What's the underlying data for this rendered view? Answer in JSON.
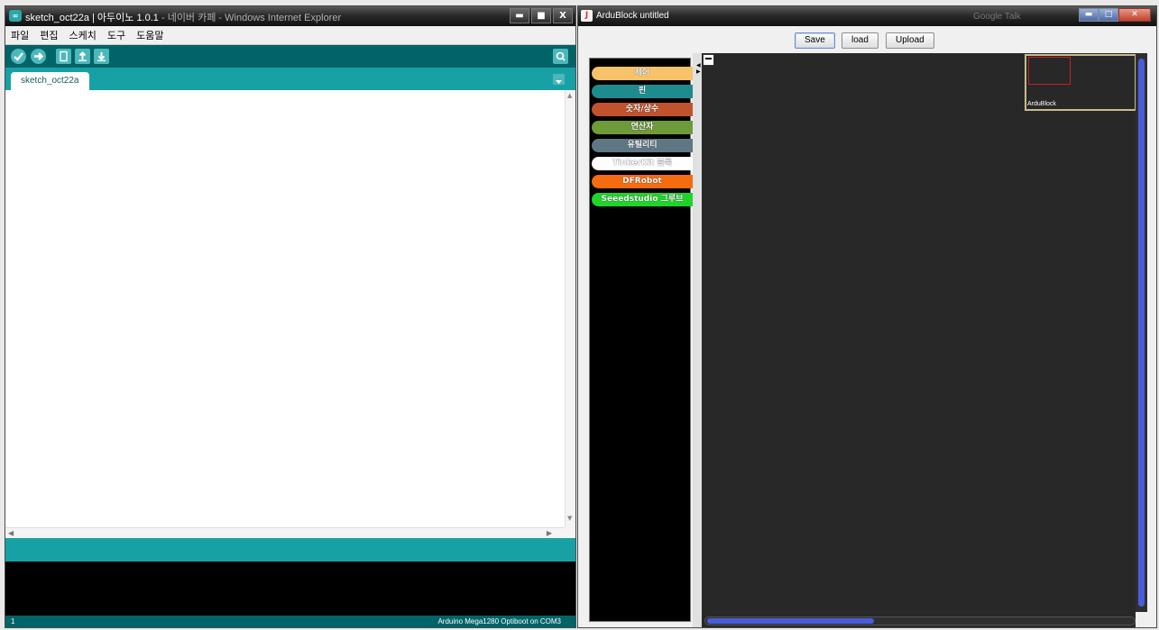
{
  "ide": {
    "title_active": "sketch_oct22a | 아두이노 1.0.1",
    "title_behind": " - 네이버 카페 - Windows Internet Explorer",
    "logo": "∞",
    "window_buttons": {
      "minimize": "▬",
      "maximize": "■",
      "close": "X"
    },
    "menu": [
      "파일",
      "편집",
      "스케치",
      "도구",
      "도움말"
    ],
    "toolbar": {
      "buttons": [
        "verify-icon",
        "upload-arrow-icon",
        "new-file-icon",
        "open-file-icon",
        "save-file-icon"
      ],
      "serial_monitor": "serial-monitor-icon"
    },
    "tab": {
      "label": "sketch_oct22a"
    },
    "scroll": {
      "up": "▲",
      "down": "▼",
      "left": "◀",
      "right": "▶"
    },
    "footer": {
      "line": "1",
      "board": "Arduino Mega1280 Optiboot on COM3"
    },
    "colors": {
      "dark_teal": "#006468",
      "teal": "#17a1a5",
      "button": "#4db7bb"
    }
  },
  "ardublock": {
    "title": "ArduBlock untitled",
    "background_app": "Google Talk",
    "window_buttons": {
      "minimize": "▬",
      "maximize": "□",
      "close": "✕"
    },
    "buttons": {
      "save": "Save",
      "load": "load",
      "upload": "Upload"
    },
    "categories": [
      {
        "label": "제어",
        "color": "#f7c26a"
      },
      {
        "label": "핀",
        "color": "#1e8c8e"
      },
      {
        "label": "숫자/상수",
        "color": "#c0532e"
      },
      {
        "label": "연산자",
        "color": "#6f9a3a"
      },
      {
        "label": "유틸리티",
        "color": "#5f7683"
      },
      {
        "label": "TinkerKit 블록",
        "color": "#ffffff"
      },
      {
        "label": "DFRobot",
        "color": "#f46b10"
      },
      {
        "label": "Seeedstudio 그루브",
        "color": "#1fd52a"
      }
    ],
    "minimap": {
      "label": "ArduBlock"
    },
    "colors": {
      "workspace": "#282828",
      "scroll_thumb": "#4a5dd8"
    }
  }
}
